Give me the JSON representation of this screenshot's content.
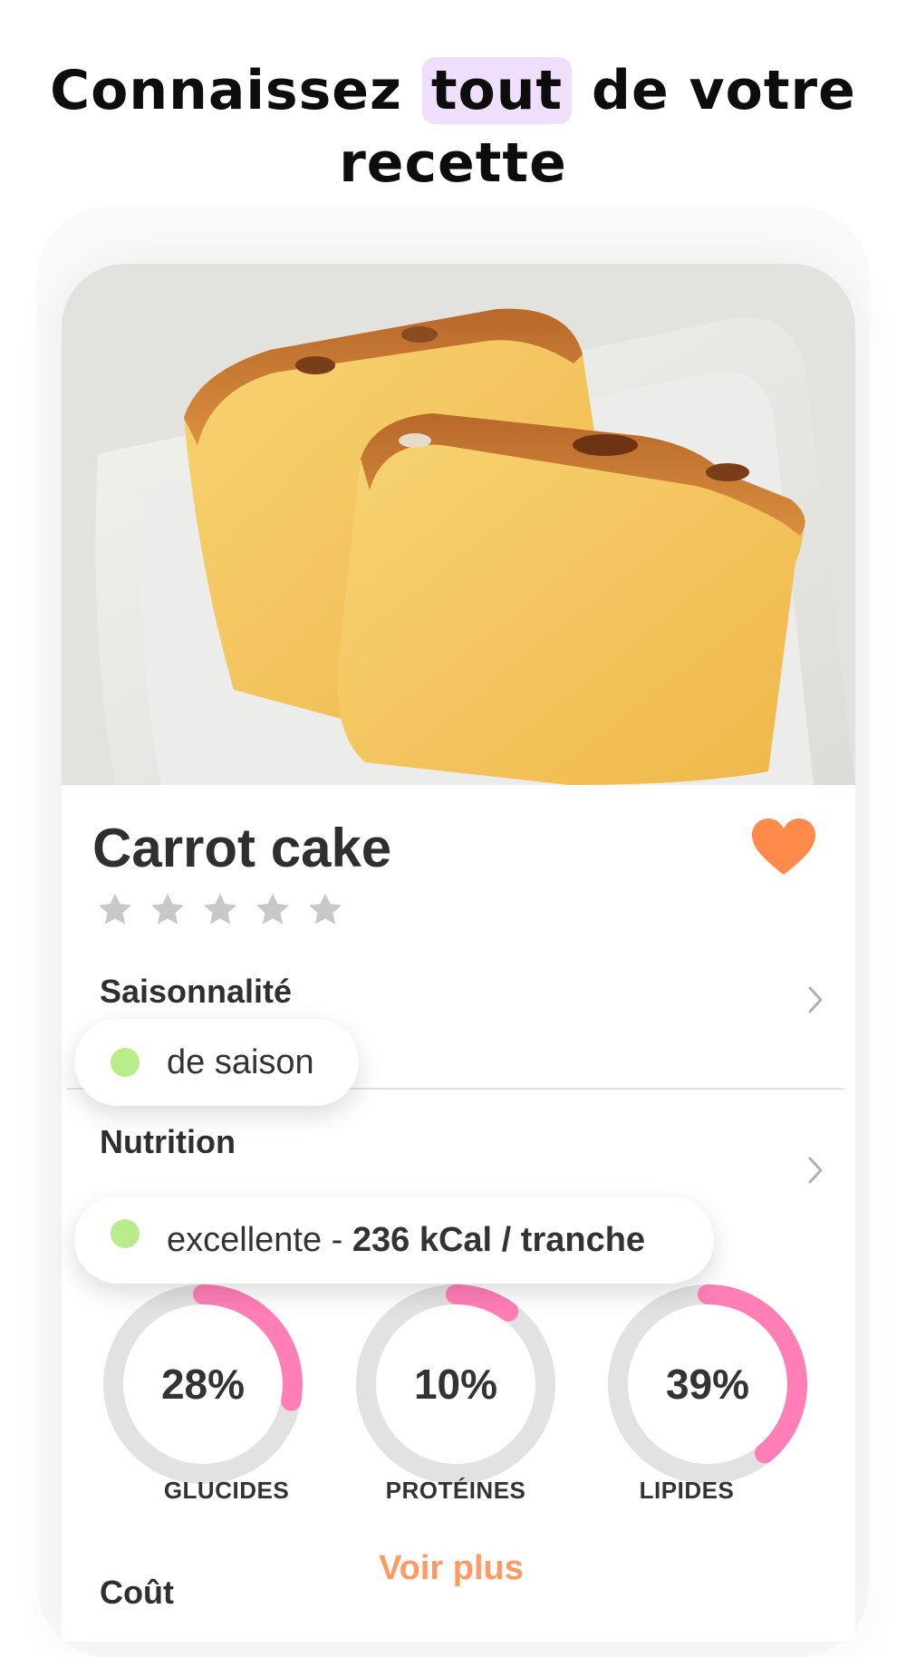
{
  "headline": {
    "before": "Connaissez",
    "highlight": "tout",
    "after": "de votre",
    "line2": "recette"
  },
  "recipe": {
    "title": "Carrot cake",
    "rating": 0,
    "rating_max": 5,
    "favorite": true
  },
  "seasonality": {
    "label": "Saisonnalité",
    "value": "de saison",
    "status_color": "#b9ec8a"
  },
  "nutrition": {
    "label": "Nutrition",
    "quality": "excellente - ",
    "calories": "236 kCal / tranche",
    "status_color": "#b9ec8a",
    "macros": [
      {
        "name": "GLUCIDES",
        "value": "28%",
        "percent": 28
      },
      {
        "name": "PROTÉINES",
        "value": "10%",
        "percent": 10
      },
      {
        "name": "LIPIDES",
        "value": "39%",
        "percent": 39
      }
    ],
    "ring_color": "#ff7eb6",
    "ring_track_color": "#e2e2e2"
  },
  "voir_plus": "Voir plus",
  "cost": {
    "label": "Coût"
  },
  "colors": {
    "accent": "#ff9a63",
    "heart": "#ff8a4c",
    "highlight": "#efdefc"
  },
  "icons": {
    "favorite": "heart-icon",
    "star": "star-icon",
    "chevron": "chevron-right-icon"
  }
}
